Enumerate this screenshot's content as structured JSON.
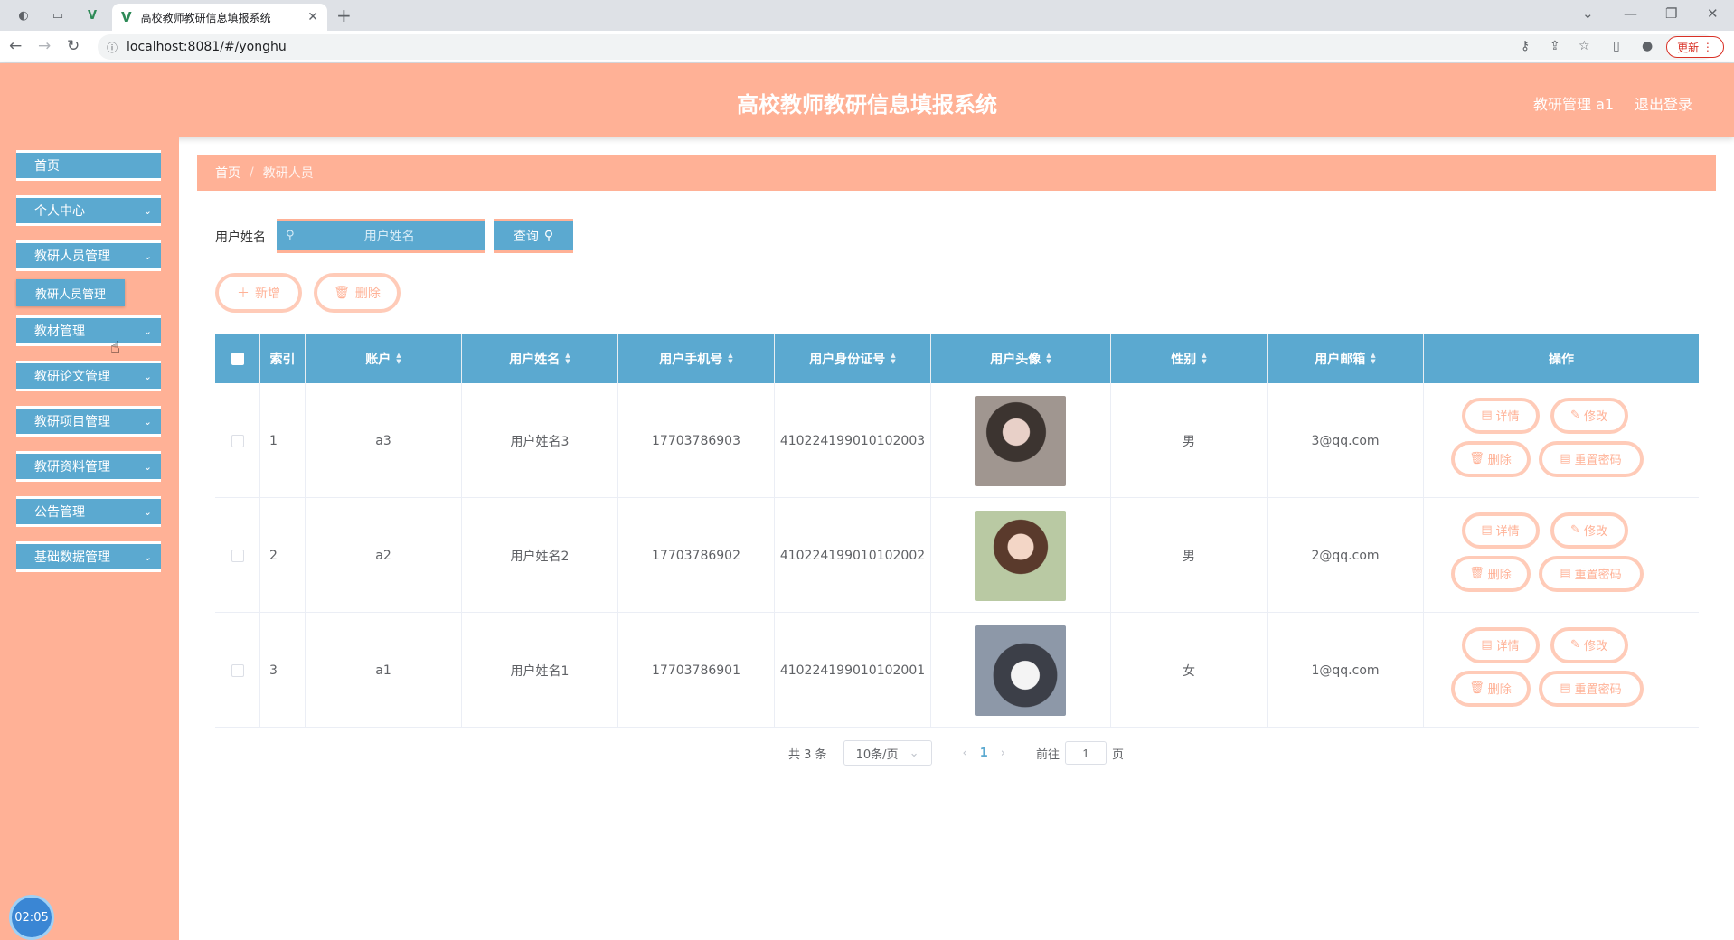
{
  "browser": {
    "tab_title": "高校教师教研信息填报系统",
    "url": "localhost:8081/#/yonghu",
    "update_label": "更新"
  },
  "header": {
    "title": "高校教师教研信息填报系统",
    "user_label": "教研管理 a1",
    "logout_label": "退出登录"
  },
  "sidebar": {
    "items": [
      {
        "label": "首页"
      },
      {
        "label": "个人中心"
      },
      {
        "label": "教研人员管理"
      },
      {
        "label": "教材管理"
      },
      {
        "label": "教研论文管理"
      },
      {
        "label": "教研项目管理"
      },
      {
        "label": "教研资料管理"
      },
      {
        "label": "公告管理"
      },
      {
        "label": "基础数据管理"
      }
    ],
    "submenu_label": "教研人员管理",
    "timer": "02:05"
  },
  "breadcrumb": {
    "home": "首页",
    "separator": "/",
    "current": "教研人员"
  },
  "search": {
    "label": "用户姓名",
    "placeholder": "用户姓名",
    "value": "",
    "query_label": "查询"
  },
  "actions": {
    "add_label": "新增",
    "delete_label": "删除"
  },
  "table": {
    "headers": {
      "index": "索引",
      "account": "账户",
      "name": "用户姓名",
      "phone": "用户手机号",
      "id_card": "用户身份证号",
      "avatar": "用户头像",
      "gender": "性别",
      "email": "用户邮箱",
      "ops": "操作"
    },
    "rows": [
      {
        "index": "1",
        "account": "a3",
        "name": "用户姓名3",
        "phone": "17703786903",
        "id_card": "410224199010102003",
        "gender": "男",
        "email": "3@qq.com"
      },
      {
        "index": "2",
        "account": "a2",
        "name": "用户姓名2",
        "phone": "17703786902",
        "id_card": "410224199010102002",
        "gender": "男",
        "email": "2@qq.com"
      },
      {
        "index": "3",
        "account": "a1",
        "name": "用户姓名1",
        "phone": "17703786901",
        "id_card": "410224199010102001",
        "gender": "女",
        "email": "1@qq.com"
      }
    ],
    "op_labels": {
      "detail": "详情",
      "edit": "修改",
      "delete": "删除",
      "reset": "重置密码"
    }
  },
  "pagination": {
    "total_text": "共 3 条",
    "page_size": "10条/页",
    "current_page": "1",
    "goto_prefix": "前往",
    "goto_value": "1",
    "goto_suffix": "页"
  },
  "colors": {
    "header_bg": "#ffb196",
    "accent_blue": "#5ba9d0",
    "pill_border": "#ffcbb8"
  }
}
